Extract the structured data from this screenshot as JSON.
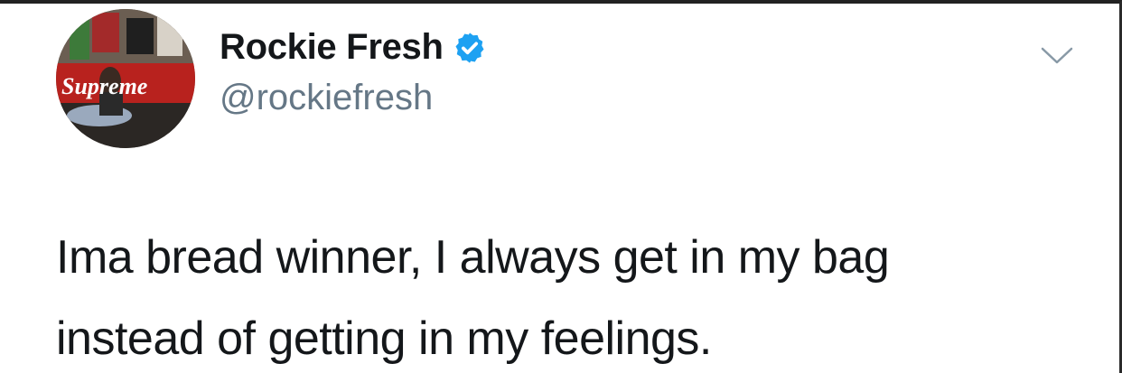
{
  "tweet": {
    "author": {
      "display_name": "Rockie Fresh",
      "handle": "@rockiefresh",
      "verified": true,
      "avatar_icon": "profile-photo",
      "avatar_logo_text": "Supreme"
    },
    "text_lines": [
      "Ima bread winner, I always get in my bag",
      "instead of getting in my feelings."
    ],
    "menu_icon": "chevron-down-icon"
  },
  "colors": {
    "text": "#14171a",
    "secondary_text": "#657786",
    "verified_blue": "#1da1f2",
    "chevron": "#8899a6"
  }
}
